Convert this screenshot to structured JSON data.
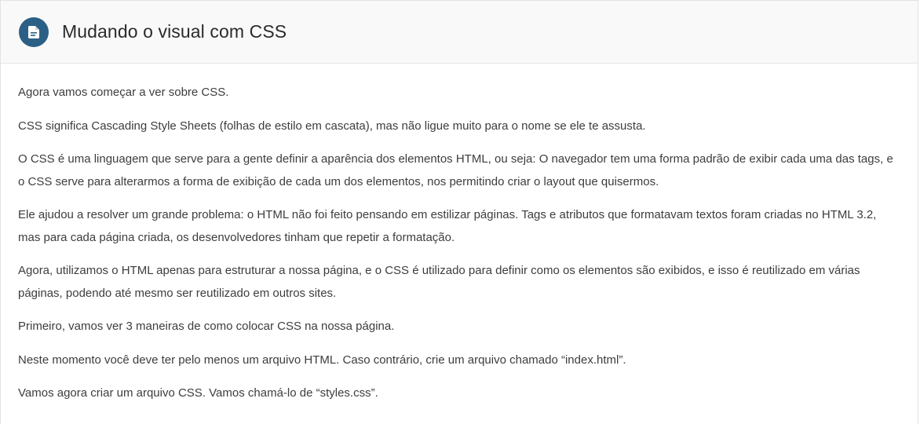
{
  "header": {
    "icon": "document-icon",
    "title": "Mudando o visual com CSS"
  },
  "content": {
    "paragraphs": [
      "Agora vamos começar a ver sobre CSS.",
      "CSS significa Cascading Style Sheets (folhas de estilo em cascata), mas não ligue muito para o nome se ele te assusta.",
      "O CSS é uma linguagem que serve para a gente definir a aparência dos elementos HTML, ou seja: O navegador tem uma forma padrão de exibir cada uma das tags, e o CSS serve para alterarmos a forma de exibição de cada um dos elementos, nos permitindo criar o layout que quisermos.",
      "Ele ajudou a resolver um grande problema: o HTML não foi feito pensando em estilizar páginas. Tags e atributos que formatavam textos foram criadas no HTML 3.2, mas para cada página criada, os desenvolvedores tinham que repetir a formatação.",
      "Agora, utilizamos o HTML apenas para estruturar a nossa página, e o CSS é utilizado para definir como os elementos são exibidos, e isso é reutilizado em várias páginas, podendo até mesmo ser reutilizado em outros sites.",
      "Primeiro, vamos ver 3 maneiras de como colocar CSS na nossa página.",
      "Neste momento você deve ter pelo menos um arquivo HTML. Caso contrário, crie um arquivo chamado “index.html”.",
      "Vamos agora criar um arquivo CSS. Vamos chamá-lo de “styles.css”."
    ]
  },
  "colors": {
    "icon_background": "#2c5f85",
    "header_background": "#f9f9f9",
    "text": "#3d3d3d"
  }
}
